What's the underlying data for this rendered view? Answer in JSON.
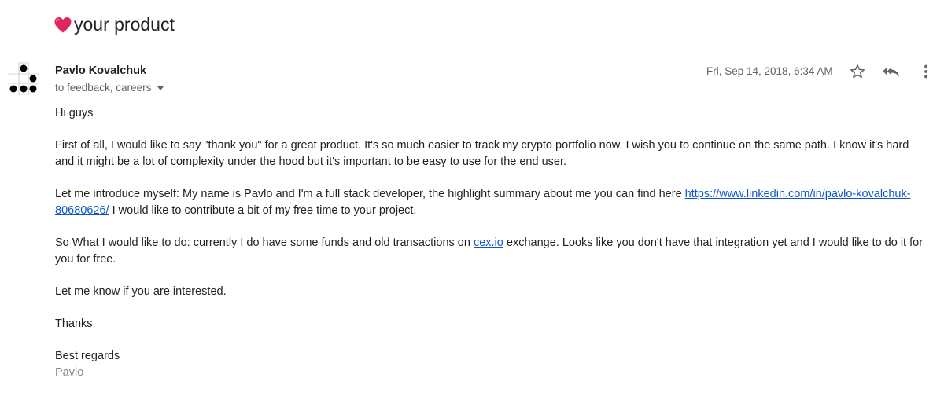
{
  "subject": {
    "icon": "heart-icon",
    "text": "your product"
  },
  "message": {
    "sender_name": "Pavlo Kovalchuk",
    "recipients": "to feedback, careers",
    "date": "Fri, Sep 14, 2018, 6:34 AM",
    "greeting": "Hi guys",
    "paragraph_1": "First of all, I would like to say \"thank you\" for a great product. It's so much easier to track my crypto portfolio now. I wish you to continue on the same path. I know it's hard and it might be a lot of complexity under the hood but it's important to be easy to use for the end user.",
    "paragraph_2_before": "Let me introduce myself: My name is Pavlo and I'm a full stack developer, the highlight summary about me you can find here ",
    "paragraph_2_link": "https://www.linkedin.com/in/pavlo-kovalchuk-80680626/",
    "paragraph_2_after": " I would like to contribute a bit of my free time to your project.",
    "paragraph_3_before": "So What I would like to do: currently I do have some funds and old transactions on ",
    "paragraph_3_link": "cex.io",
    "paragraph_3_after": " exchange. Looks like you don't have that integration yet and I would like to do it for you for free.",
    "paragraph_4": "Let me know if you are interested.",
    "paragraph_5": "Thanks",
    "closing": "Best regards",
    "signature": "Pavlo"
  },
  "actions": {
    "star_icon": "star-icon",
    "reply_all_icon": "reply-all-icon",
    "more_icon": "more-vert-icon"
  },
  "colors": {
    "link": "#1155cc",
    "heart": "#e0245e",
    "secondary_text": "#5f6368"
  }
}
